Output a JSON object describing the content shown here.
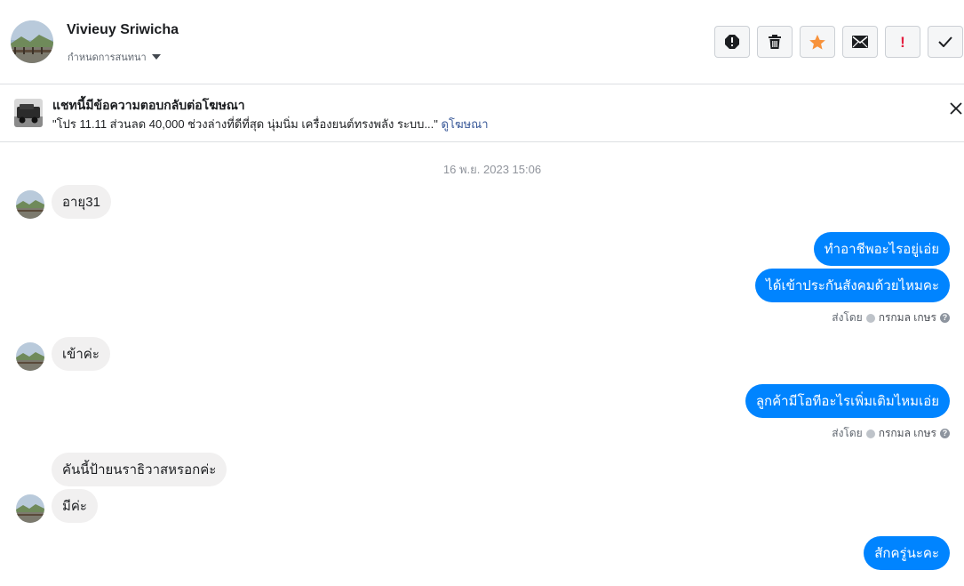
{
  "header": {
    "contact_name": "Vivieuy Sriwicha",
    "conversation_settings_label": "กำหนดการสนทนา",
    "actions": [
      {
        "name": "report-spam-icon",
        "label": "report"
      },
      {
        "name": "trash-icon",
        "label": "delete"
      },
      {
        "name": "star-icon",
        "label": "star",
        "color": "#f7923b"
      },
      {
        "name": "envelope-icon",
        "label": "mark unread"
      },
      {
        "name": "important-icon",
        "label": "follow up",
        "color": "#e41e3f"
      },
      {
        "name": "checkmark-icon",
        "label": "done"
      }
    ]
  },
  "ad_banner": {
    "title": "แชทนี้มีข้อความตอบกลับต่อโฆษณา",
    "text": "\"โปร 11.11 ส่วนลด 40,000 ช่วงล่างที่ดีที่สุด นุ่มนิ่ม เครื่องยนต์ทรงพลัง ระบบ...\"",
    "link_label": "ดูโฆษณา"
  },
  "timestamp": "16 พ.ย. 2023 15:06",
  "messages": {
    "m1": "อายุ31",
    "m2": "ทำอาชีพอะไรอยู่เอ่ย",
    "m3": "ได้เข้าประกันสังคมด้วยไหมคะ",
    "m4": "เข้าค่ะ",
    "m5": "ลูกค้ามีโอทีอะไรเพิ่มเติมไหมเอ่ย",
    "m6": "คันนี้ป้ายนราธิวาสหรอกค่ะ",
    "m7": "มีค่ะ",
    "m8": "สักครู่นะคะ"
  },
  "sent_by": {
    "label": "ส่งโดย",
    "user": "กรกมล เกษร"
  },
  "colors": {
    "outgoing_bubble": "#0084ff",
    "incoming_bubble": "#f1f0f0",
    "link": "#385898"
  }
}
